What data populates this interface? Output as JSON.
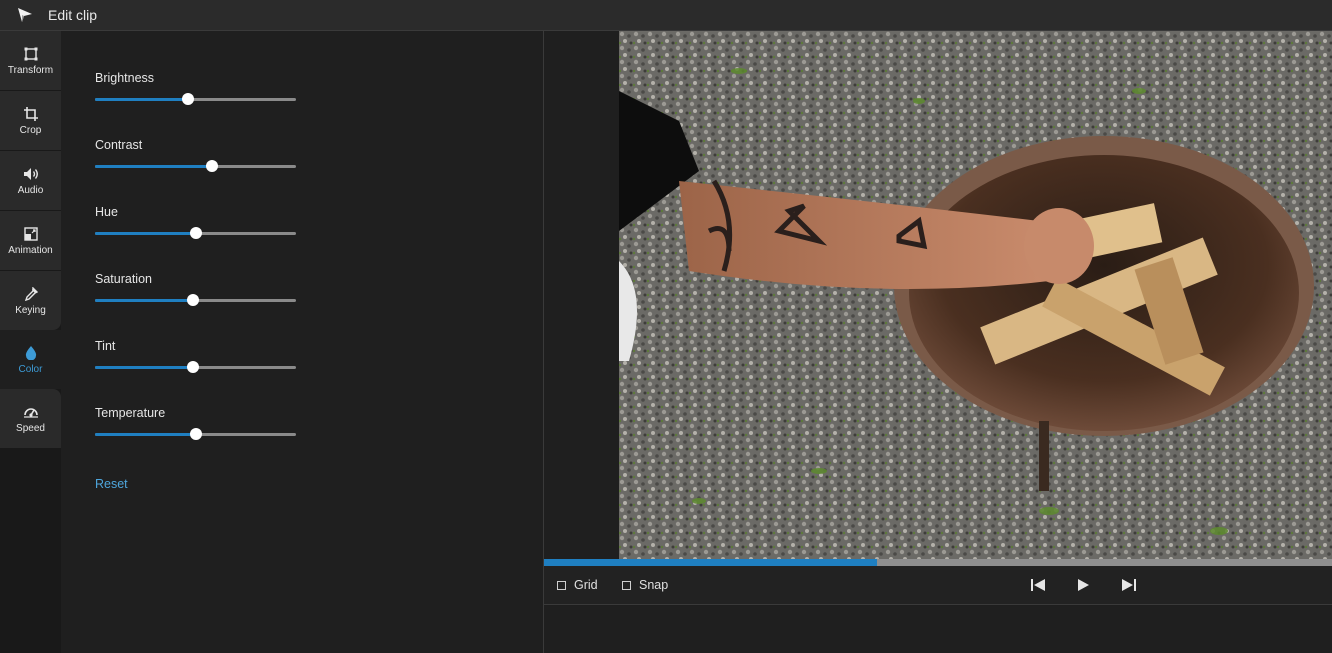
{
  "titlebar": {
    "title": "Edit clip"
  },
  "tools": [
    {
      "label": "Transform",
      "icon": "transform-icon"
    },
    {
      "label": "Crop",
      "icon": "crop-icon"
    },
    {
      "label": "Audio",
      "icon": "speaker-icon"
    },
    {
      "label": "Animation",
      "icon": "animation-icon"
    },
    {
      "label": "Keying",
      "icon": "eyedropper-icon"
    },
    {
      "label": "Color",
      "icon": "droplet-icon",
      "active": true
    },
    {
      "label": "Speed",
      "icon": "speedometer-icon"
    }
  ],
  "sliders": [
    {
      "label": "Brightness",
      "value": 0.465
    },
    {
      "label": "Contrast",
      "value": 0.58
    },
    {
      "label": "Hue",
      "value": 0.5
    },
    {
      "label": "Saturation",
      "value": 0.49
    },
    {
      "label": "Tint",
      "value": 0.49
    },
    {
      "label": "Temperature",
      "value": 0.5
    }
  ],
  "reset_label": "Reset",
  "player": {
    "progress": 0.422,
    "grid_label": "Grid",
    "snap_label": "Snap",
    "grid_checked": false,
    "snap_checked": false
  },
  "colors": {
    "accent": "#1f7fc1",
    "link": "#4ea6dc",
    "active_tool": "#3d9bd6"
  }
}
